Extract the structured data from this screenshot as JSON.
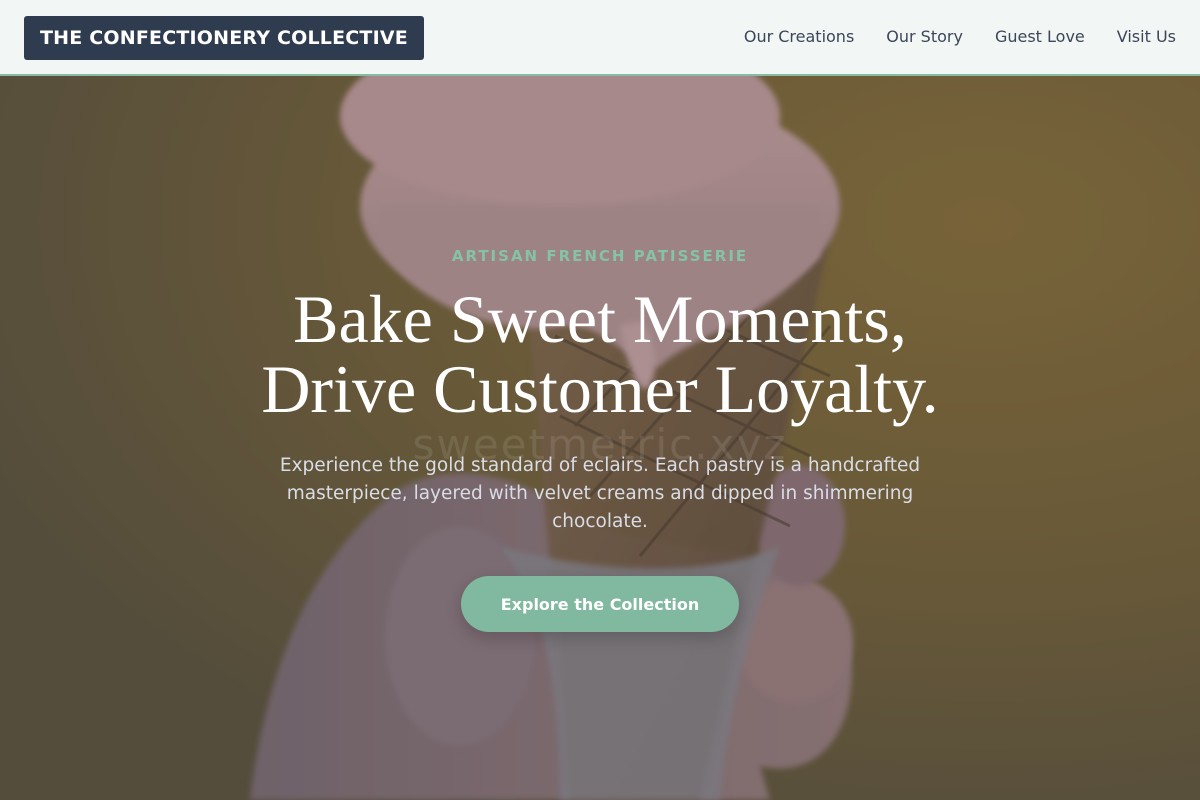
{
  "brand": {
    "name": "THE CONFECTIONERY COLLECTIVE"
  },
  "nav": {
    "links": [
      "Our Creations",
      "Our Story",
      "Guest Love",
      "Visit Us"
    ]
  },
  "hero": {
    "eyebrow": "ARTISAN FRENCH PATISSERIE",
    "headline_line1": "Bake Sweet Moments,",
    "headline_line2": "Drive Customer Loyalty.",
    "watermark": "sweetmetric.xyz",
    "subtext": "Experience the gold standard of eclairs. Each pastry is a handcrafted masterpiece, layered with velvet creams and dipped in shimmering chocolate.",
    "cta_label": "Explore the Collection",
    "image": "ice-cream-cone-in-hand-photo"
  },
  "colors": {
    "logo_bg": "#2f3b4e",
    "accent": "#80b8a0",
    "eyebrow": "#86c2a4",
    "nav_bg": "#f2f6f5",
    "hero_bg": "#6d5f45"
  }
}
